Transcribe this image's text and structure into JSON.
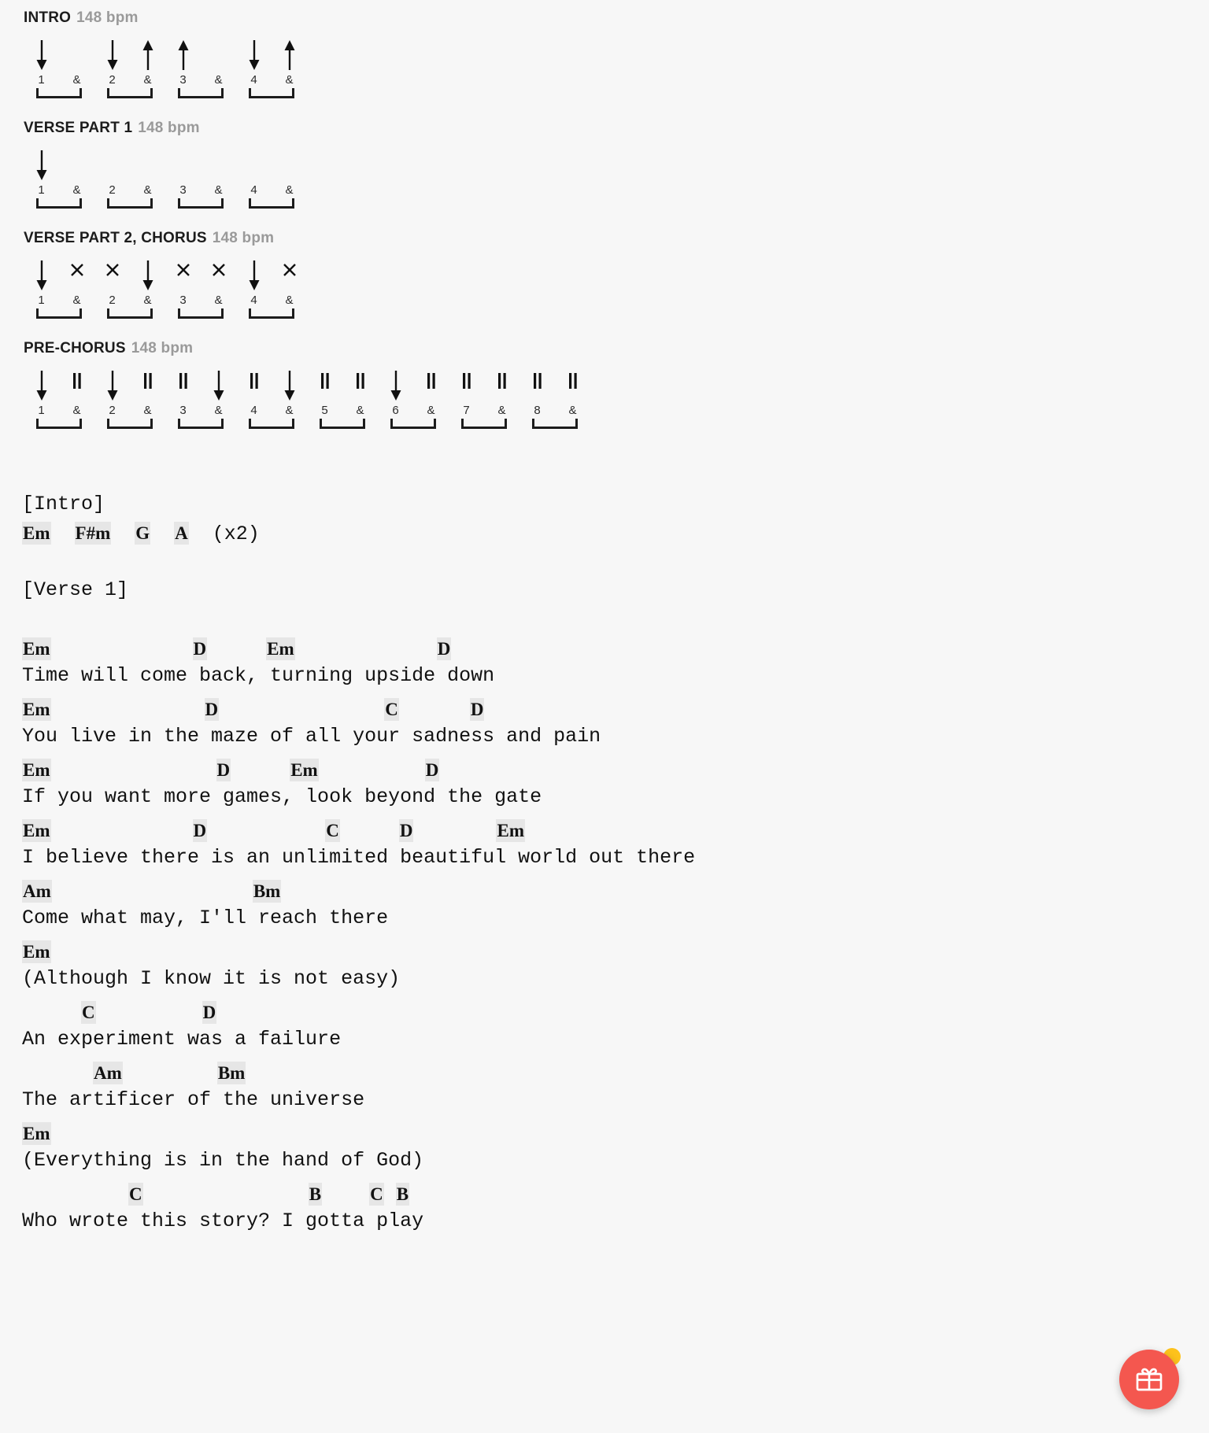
{
  "patterns": [
    {
      "title": "INTRO",
      "bpm": "148 bpm",
      "beats": [
        "1",
        "&",
        "2",
        "&",
        "3",
        "&",
        "4",
        "&"
      ],
      "strums": [
        "down",
        "none",
        "down",
        "up",
        "up",
        "none",
        "down",
        "up"
      ]
    },
    {
      "title": "VERSE PART 1",
      "bpm": "148 bpm",
      "beats": [
        "1",
        "&",
        "2",
        "&",
        "3",
        "&",
        "4",
        "&"
      ],
      "strums": [
        "down",
        "none",
        "none",
        "none",
        "none",
        "none",
        "none",
        "none"
      ]
    },
    {
      "title": "VERSE PART 2, CHORUS",
      "bpm": "148 bpm",
      "beats": [
        "1",
        "&",
        "2",
        "&",
        "3",
        "&",
        "4",
        "&"
      ],
      "strums": [
        "down",
        "mute",
        "mute",
        "down",
        "mute",
        "mute",
        "down",
        "mute"
      ]
    },
    {
      "title": "PRE-CHORUS",
      "bpm": "148 bpm",
      "beats": [
        "1",
        "&",
        "2",
        "&",
        "3",
        "&",
        "4",
        "&",
        "5",
        "&",
        "6",
        "&",
        "7",
        "&",
        "8",
        "&"
      ],
      "strums": [
        "down",
        "rest",
        "down",
        "rest",
        "rest",
        "down",
        "rest",
        "down",
        "rest",
        "rest",
        "down",
        "rest",
        "rest",
        "rest",
        "rest",
        "rest"
      ]
    }
  ],
  "sheet": [
    {
      "type": "label",
      "text": "[Intro]"
    },
    {
      "type": "chords",
      "text": "Em  F#m  G  A  (x2)",
      "chords": [
        "Em",
        "F#m",
        "G",
        "A"
      ]
    },
    {
      "type": "blank"
    },
    {
      "type": "label",
      "text": "[Verse 1]"
    },
    {
      "type": "blank"
    },
    {
      "type": "chords",
      "text": "Em            D     Em            D"
    },
    {
      "type": "lyric",
      "text": "Time will come back, turning upside down"
    },
    {
      "type": "chords",
      "text": "Em             D              C      D"
    },
    {
      "type": "lyric",
      "text": "You live in the maze of all your sadness and pain"
    },
    {
      "type": "chords",
      "text": "Em              D     Em         D"
    },
    {
      "type": "lyric",
      "text": "If you want more games, look beyond the gate"
    },
    {
      "type": "chords",
      "text": "Em            D          C     D       Em"
    },
    {
      "type": "lyric",
      "text": "I believe there is an unlimited beautiful world out there"
    },
    {
      "type": "chords",
      "text": "Am                 Bm"
    },
    {
      "type": "lyric",
      "text": "Come what may, I'll reach there"
    },
    {
      "type": "chords",
      "text": "Em"
    },
    {
      "type": "lyric",
      "text": "(Although I know it is not easy)"
    },
    {
      "type": "chords",
      "text": "     C         D"
    },
    {
      "type": "lyric",
      "text": "An experiment was a failure"
    },
    {
      "type": "chords",
      "text": "      Am        Bm"
    },
    {
      "type": "lyric",
      "text": "The artificer of the universe"
    },
    {
      "type": "chords",
      "text": "Em"
    },
    {
      "type": "lyric",
      "text": "(Everything is in the hand of God)"
    },
    {
      "type": "chords",
      "text": "         C              B    C B"
    },
    {
      "type": "lyric",
      "text": "Who wrote this story? I gotta play"
    }
  ],
  "gift": {
    "icon": "gift-icon",
    "color": "#f4574f",
    "badge_color": "#fdc21c"
  }
}
